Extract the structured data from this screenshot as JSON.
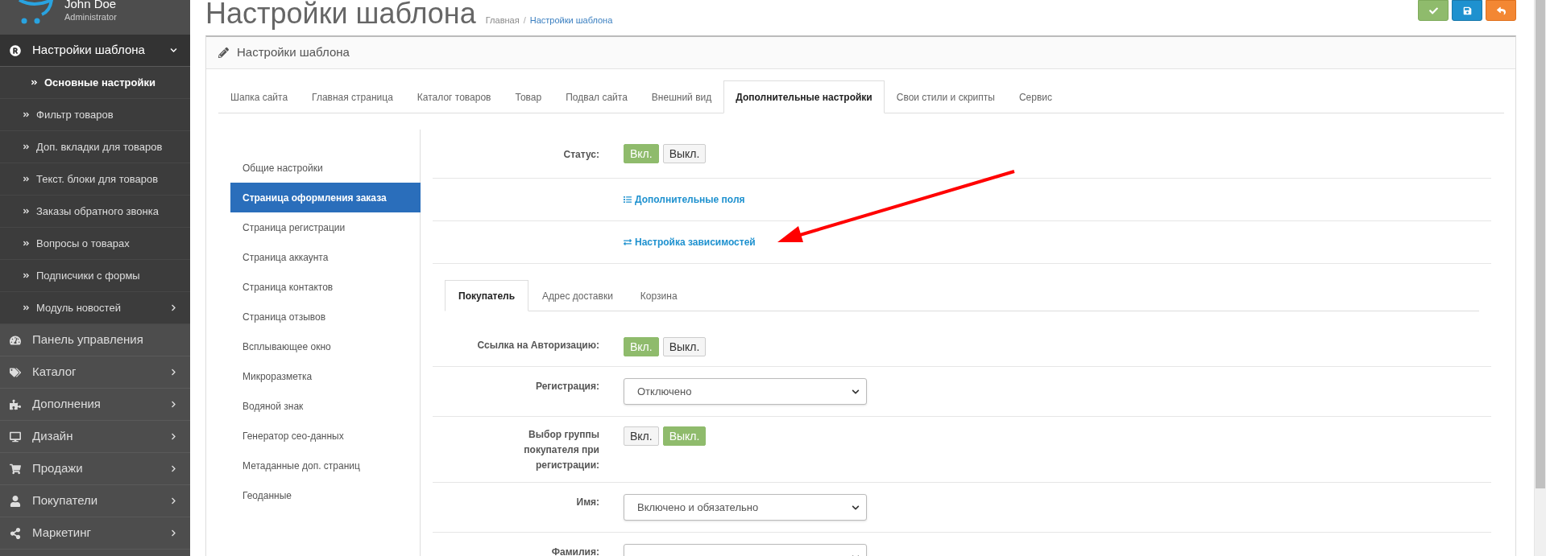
{
  "sidebar": {
    "user": {
      "name": "John Doe",
      "role": "Administrator"
    },
    "menu": [
      {
        "label": "Настройки шаблона",
        "expandable": true,
        "expanded": true,
        "children": [
          {
            "label": "Основные настройки",
            "selected": true,
            "expandable": false
          },
          {
            "label": "Фильтр товаров",
            "selected": false,
            "expandable": false
          },
          {
            "label": "Доп. вкладки для товаров",
            "selected": false,
            "expandable": false
          },
          {
            "label": "Текст. блоки для товаров",
            "selected": false,
            "expandable": false
          },
          {
            "label": "Заказы обратного звонка",
            "selected": false,
            "expandable": false
          },
          {
            "label": "Вопросы о товарах",
            "selected": false,
            "expandable": false
          },
          {
            "label": "Подписчики с формы",
            "selected": false,
            "expandable": false
          },
          {
            "label": "Модуль новостей",
            "selected": false,
            "expandable": true
          }
        ]
      },
      {
        "label": "Панель управления",
        "expandable": false,
        "expanded": false
      },
      {
        "label": "Каталог",
        "expandable": true,
        "expanded": false
      },
      {
        "label": "Дополнения",
        "expandable": true,
        "expanded": false
      },
      {
        "label": "Дизайн",
        "expandable": true,
        "expanded": false
      },
      {
        "label": "Продажи",
        "expandable": true,
        "expanded": false
      },
      {
        "label": "Покупатели",
        "expandable": true,
        "expanded": false
      },
      {
        "label": "Маркетинг",
        "expandable": true,
        "expanded": false
      }
    ]
  },
  "page": {
    "title": "Настройки шаблона",
    "breadcrumb": {
      "separator": "/",
      "items": [
        {
          "label": "Главная",
          "current": false
        },
        {
          "label": "Настройки шаблона",
          "current": true
        }
      ]
    },
    "toolbar": [
      {
        "kind": "apply"
      },
      {
        "kind": "save"
      },
      {
        "kind": "back"
      }
    ]
  },
  "panel": {
    "title": "Настройки шаблона",
    "tabs": [
      {
        "label": "Шапка сайта",
        "selected": false
      },
      {
        "label": "Главная страница",
        "selected": false
      },
      {
        "label": "Каталог товаров",
        "selected": false
      },
      {
        "label": "Товар",
        "selected": false
      },
      {
        "label": "Подвал сайта",
        "selected": false
      },
      {
        "label": "Внешний вид",
        "selected": false
      },
      {
        "label": "Дополнительные настройки",
        "selected": true
      },
      {
        "label": "Свои стили и скрипты",
        "selected": false
      },
      {
        "label": "Сервис",
        "selected": false
      }
    ],
    "side_nav": [
      {
        "label": "Общие настройки",
        "selected": false
      },
      {
        "label": "Страница оформления заказа",
        "selected": true
      },
      {
        "label": "Страница регистрации",
        "selected": false
      },
      {
        "label": "Страница аккаунта",
        "selected": false
      },
      {
        "label": "Страница контактов",
        "selected": false
      },
      {
        "label": "Страница отзывов",
        "selected": false
      },
      {
        "label": "Всплывающее окно",
        "selected": false
      },
      {
        "label": "Микроразметка",
        "selected": false
      },
      {
        "label": "Водяной знак",
        "selected": false
      },
      {
        "label": "Генератор сео-данных",
        "selected": false
      },
      {
        "label": "Метаданные доп. страниц",
        "selected": false
      },
      {
        "label": "Геоданные",
        "selected": false
      }
    ],
    "settings": [
      {
        "kind": "toggle",
        "label": "Статус:",
        "options": [
          {
            "label": "Вкл.",
            "selected": true
          },
          {
            "label": "Выкл.",
            "selected": false
          }
        ]
      },
      {
        "kind": "list_link",
        "text": "Дополнительные поля"
      },
      {
        "kind": "swap_link",
        "text": "Настройка зависимостей"
      }
    ],
    "subtabs": [
      {
        "label": "Покупатель",
        "selected": true
      },
      {
        "label": "Адрес доставки",
        "selected": false
      },
      {
        "label": "Корзина",
        "selected": false
      }
    ],
    "form": [
      {
        "kind": "toggle",
        "label": "Ссылка на Авторизацию:",
        "options": [
          {
            "label": "Вкл.",
            "selected": true
          },
          {
            "label": "Выкл.",
            "selected": false
          }
        ]
      },
      {
        "kind": "select",
        "label": "Регистрация:",
        "value": "Отключено"
      },
      {
        "kind": "toggle",
        "label": "Выбор группы покупателя при регистрации:",
        "options": [
          {
            "label": "Вкл.",
            "selected": false
          },
          {
            "label": "Выкл.",
            "selected": true
          }
        ]
      },
      {
        "kind": "select",
        "label": "Имя:",
        "value": "Включено и обязательно"
      },
      {
        "kind": "select",
        "label": "Фамилия:"
      }
    ]
  }
}
